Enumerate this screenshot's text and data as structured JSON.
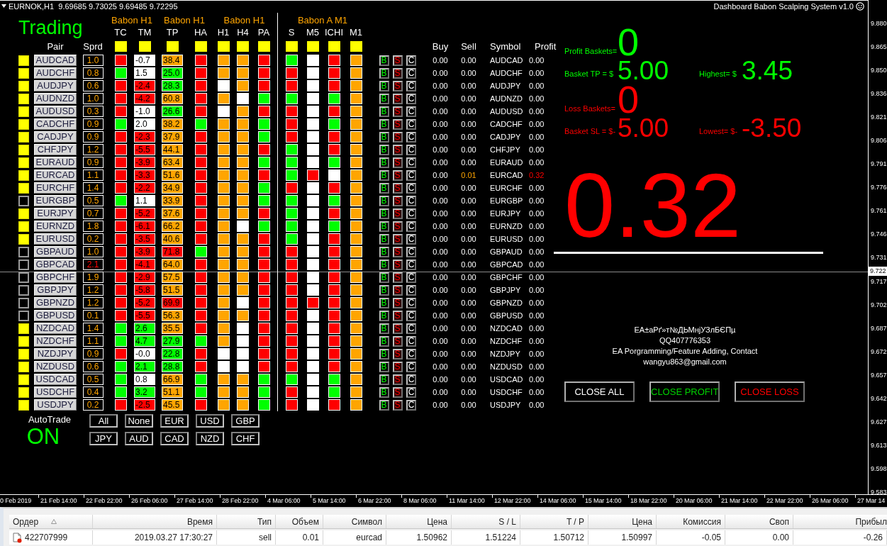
{
  "chart": {
    "symbol_line": "EURNOK,H1  9.69685 9.73025 9.69485 9.72295",
    "title": "Dashboard Babon Scalping System v1.0"
  },
  "dashboard": {
    "heading": "Trading",
    "pair_label": "Pair",
    "spread_label": "Sprd",
    "groups": [
      {
        "label": "Babon H1",
        "columns": [
          {
            "label": "TC",
            "toggle": true
          },
          {
            "label": "TM",
            "toggle": true
          }
        ]
      },
      {
        "label": "Babon H1",
        "columns": [
          {
            "label": "TP",
            "toggle": true
          },
          {
            "label": "HA",
            "toggle": true
          }
        ]
      },
      {
        "label": "Babon H1",
        "columns": [
          {
            "label": "H1",
            "toggle": true
          },
          {
            "label": "H4",
            "toggle": true
          },
          {
            "label": "PA",
            "toggle": true
          }
        ]
      },
      {
        "label": "Babon A M1",
        "columns": [
          {
            "label": "S",
            "toggle": true
          },
          {
            "label": "M5",
            "toggle": true
          },
          {
            "label": "ICHI",
            "toggle": true
          },
          {
            "label": "M1",
            "toggle": true
          }
        ]
      }
    ],
    "trade_columns": [
      "Buy",
      "Sell",
      "Symbol",
      "Profit"
    ],
    "rows": [
      {
        "selected": true,
        "pair": "AUDCAD",
        "spread": "1.0",
        "spread_alert": false,
        "cells": [
          {
            "color": "#ff0000"
          },
          {
            "value": "-0.7",
            "color": "#ffffff"
          },
          {
            "value": "38.4",
            "color": "#ffa500"
          },
          {
            "color": "#ff0000"
          },
          {
            "color": "#ffa500"
          },
          {
            "color": "#ffa500"
          },
          {
            "color": "#ff0000"
          },
          {
            "color": "#00ff00"
          },
          {
            "color": "#ffffff"
          },
          {
            "color": "#ff0000"
          },
          {
            "color": "#ffa500"
          }
        ],
        "actions": [
          "B",
          "S",
          "C"
        ],
        "buy": "0.00",
        "sell": "0.00",
        "symbol": "AUDCAD",
        "profit": "0.00",
        "open": false
      },
      {
        "selected": true,
        "pair": "AUDCHF",
        "spread": "0.8",
        "spread_alert": false,
        "cells": [
          {
            "color": "#00ff00"
          },
          {
            "value": "1.5",
            "color": "#ffffff"
          },
          {
            "value": "25.0",
            "color": "#00ff00"
          },
          {
            "color": "#ff0000"
          },
          {
            "color": "#ffa500"
          },
          {
            "color": "#ffa500"
          },
          {
            "color": "#ff0000"
          },
          {
            "color": "#ff0000"
          },
          {
            "color": "#ffffff"
          },
          {
            "color": "#ff0000"
          },
          {
            "color": "#ffa500"
          }
        ],
        "actions": [
          "B",
          "S",
          "C"
        ],
        "buy": "0.00",
        "sell": "0.00",
        "symbol": "AUDCHF",
        "profit": "0.00",
        "open": false
      },
      {
        "selected": true,
        "pair": "AUDJPY",
        "spread": "0.6",
        "spread_alert": false,
        "cells": [
          {
            "color": "#ff0000"
          },
          {
            "value": "-2.4",
            "color": "#ff0000"
          },
          {
            "value": "28.3",
            "color": "#00ff00"
          },
          {
            "color": "#ff0000"
          },
          {
            "color": "#ffffff"
          },
          {
            "color": "#ffa500"
          },
          {
            "color": "#ff0000"
          },
          {
            "color": "#ff0000"
          },
          {
            "color": "#ffffff"
          },
          {
            "color": "#ff0000"
          },
          {
            "color": "#ffa500"
          }
        ],
        "actions": [
          "B",
          "S",
          "C"
        ],
        "buy": "0.00",
        "sell": "0.00",
        "symbol": "AUDJPY",
        "profit": "0.00",
        "open": false
      },
      {
        "selected": true,
        "pair": "AUDNZD",
        "spread": "1.0",
        "spread_alert": false,
        "cells": [
          {
            "color": "#ff0000"
          },
          {
            "value": "-4.2",
            "color": "#ff0000"
          },
          {
            "value": "60.8",
            "color": "#ffa500"
          },
          {
            "color": "#ff0000"
          },
          {
            "color": "#ffa500"
          },
          {
            "color": "#ffffff"
          },
          {
            "color": "#00ff00"
          },
          {
            "color": "#00ff00"
          },
          {
            "color": "#ffffff"
          },
          {
            "color": "#00ff00"
          },
          {
            "color": "#ffa500"
          }
        ],
        "actions": [
          "B",
          "S",
          "C"
        ],
        "buy": "0.00",
        "sell": "0.00",
        "symbol": "AUDNZD",
        "profit": "0.00",
        "open": false
      },
      {
        "selected": true,
        "pair": "AUDUSD",
        "spread": "0.3",
        "spread_alert": false,
        "cells": [
          {
            "color": "#ff0000"
          },
          {
            "value": "-1.0",
            "color": "#ffffff"
          },
          {
            "value": "26.6",
            "color": "#00ff00"
          },
          {
            "color": "#ff0000"
          },
          {
            "color": "#ffffff"
          },
          {
            "color": "#ffa500"
          },
          {
            "color": "#ff0000"
          },
          {
            "color": "#ff0000"
          },
          {
            "color": "#ffffff"
          },
          {
            "color": "#ff0000"
          },
          {
            "color": "#ffa500"
          }
        ],
        "actions": [
          "B",
          "S",
          "C"
        ],
        "buy": "0.00",
        "sell": "0.00",
        "symbol": "AUDUSD",
        "profit": "0.00",
        "open": false
      },
      {
        "selected": true,
        "pair": "CADCHF",
        "spread": "0.9",
        "spread_alert": false,
        "cells": [
          {
            "color": "#00ff00"
          },
          {
            "value": "2.0",
            "color": "#ffffff"
          },
          {
            "value": "38.2",
            "color": "#ffa500"
          },
          {
            "color": "#00ff00"
          },
          {
            "color": "#ffa500"
          },
          {
            "color": "#ffa500"
          },
          {
            "color": "#00ff00"
          },
          {
            "color": "#ff0000"
          },
          {
            "color": "#ffffff"
          },
          {
            "color": "#00ff00"
          },
          {
            "color": "#ffa500"
          }
        ],
        "actions": [
          "B",
          "S",
          "C"
        ],
        "buy": "0.00",
        "sell": "0.00",
        "symbol": "CADCHF",
        "profit": "0.00",
        "open": false
      },
      {
        "selected": true,
        "pair": "CADJPY",
        "spread": "0.9",
        "spread_alert": false,
        "cells": [
          {
            "color": "#ff0000"
          },
          {
            "value": "-2.3",
            "color": "#ff0000"
          },
          {
            "value": "37.9",
            "color": "#ffa500"
          },
          {
            "color": "#ff0000"
          },
          {
            "color": "#ffa500"
          },
          {
            "color": "#ffa500"
          },
          {
            "color": "#00ff00"
          },
          {
            "color": "#ff0000"
          },
          {
            "color": "#ffffff"
          },
          {
            "color": "#ff0000"
          },
          {
            "color": "#ffa500"
          }
        ],
        "actions": [
          "B",
          "S",
          "C"
        ],
        "buy": "0.00",
        "sell": "0.00",
        "symbol": "CADJPY",
        "profit": "0.00",
        "open": false
      },
      {
        "selected": true,
        "pair": "CHFJPY",
        "spread": "1.2",
        "spread_alert": false,
        "cells": [
          {
            "color": "#ff0000"
          },
          {
            "value": "-5.5",
            "color": "#ff0000"
          },
          {
            "value": "44.1",
            "color": "#ffa500"
          },
          {
            "color": "#ff0000"
          },
          {
            "color": "#ffa500"
          },
          {
            "color": "#ffa500"
          },
          {
            "color": "#ff0000"
          },
          {
            "color": "#00ff00"
          },
          {
            "color": "#ffffff"
          },
          {
            "color": "#ff0000"
          },
          {
            "color": "#ffa500"
          }
        ],
        "actions": [
          "B",
          "S",
          "C"
        ],
        "buy": "0.00",
        "sell": "0.00",
        "symbol": "CHFJPY",
        "profit": "0.00",
        "open": false
      },
      {
        "selected": true,
        "pair": "EURAUD",
        "spread": "0.9",
        "spread_alert": false,
        "cells": [
          {
            "color": "#ff0000"
          },
          {
            "value": "-3.9",
            "color": "#ff0000"
          },
          {
            "value": "63.4",
            "color": "#ffa500"
          },
          {
            "color": "#ff0000"
          },
          {
            "color": "#ffa500"
          },
          {
            "color": "#ffa500"
          },
          {
            "color": "#00ff00"
          },
          {
            "color": "#00ff00"
          },
          {
            "color": "#ffffff"
          },
          {
            "color": "#00ff00"
          },
          {
            "color": "#ffa500"
          }
        ],
        "actions": [
          "B",
          "S",
          "C"
        ],
        "buy": "0.00",
        "sell": "0.00",
        "symbol": "EURAUD",
        "profit": "0.00",
        "open": false
      },
      {
        "selected": true,
        "pair": "EURCAD",
        "spread": "1.1",
        "spread_alert": false,
        "cells": [
          {
            "color": "#ff0000"
          },
          {
            "value": "-3.3",
            "color": "#ff0000"
          },
          {
            "value": "51.6",
            "color": "#ffa500"
          },
          {
            "color": "#ff0000"
          },
          {
            "color": "#ffa500"
          },
          {
            "color": "#ffa500"
          },
          {
            "color": "#ff0000"
          },
          {
            "color": "#00ff00"
          },
          {
            "color": "#ff0000"
          },
          {
            "color": "#ffffff"
          },
          {
            "color": "#ffa500"
          }
        ],
        "actions": [
          "B",
          "S",
          "C"
        ],
        "buy": "0.00",
        "sell": "0.01",
        "symbol": "EURCAD",
        "profit": "0.32",
        "open": true
      },
      {
        "selected": true,
        "pair": "EURCHF",
        "spread": "1.4",
        "spread_alert": false,
        "cells": [
          {
            "color": "#ff0000"
          },
          {
            "value": "-2.2",
            "color": "#ff0000"
          },
          {
            "value": "34.9",
            "color": "#ffa500"
          },
          {
            "color": "#ff0000"
          },
          {
            "color": "#ffa500"
          },
          {
            "color": "#ffa500"
          },
          {
            "color": "#00ff00"
          },
          {
            "color": "#ff0000"
          },
          {
            "color": "#ffffff"
          },
          {
            "color": "#ff0000"
          },
          {
            "color": "#ffa500"
          }
        ],
        "actions": [
          "B",
          "S",
          "C"
        ],
        "buy": "0.00",
        "sell": "0.00",
        "symbol": "EURCHF",
        "profit": "0.00",
        "open": false
      },
      {
        "selected": false,
        "pair": "EURGBP",
        "spread": "0.5",
        "spread_alert": false,
        "cells": [
          {
            "color": "#00ff00"
          },
          {
            "value": "1.1",
            "color": "#ffffff"
          },
          {
            "value": "33.9",
            "color": "#ffa500"
          },
          {
            "color": "#ff0000"
          },
          {
            "color": "#ffa500"
          },
          {
            "color": "#ffa500"
          },
          {
            "color": "#00ff00"
          },
          {
            "color": "#00ff00"
          },
          {
            "color": "#ffffff"
          },
          {
            "color": "#00ff00"
          },
          {
            "color": "#ffa500"
          }
        ],
        "actions": [
          "B",
          "S",
          "C"
        ],
        "buy": "0.00",
        "sell": "0.00",
        "symbol": "EURGBP",
        "profit": "0.00",
        "open": false
      },
      {
        "selected": true,
        "pair": "EURJPY",
        "spread": "0.7",
        "spread_alert": false,
        "cells": [
          {
            "color": "#ff0000"
          },
          {
            "value": "-5.2",
            "color": "#ff0000"
          },
          {
            "value": "37.6",
            "color": "#ffa500"
          },
          {
            "color": "#ff0000"
          },
          {
            "color": "#ffa500"
          },
          {
            "color": "#ffa500"
          },
          {
            "color": "#ff0000"
          },
          {
            "color": "#00ff00"
          },
          {
            "color": "#ffffff"
          },
          {
            "color": "#ff0000"
          },
          {
            "color": "#ffa500"
          }
        ],
        "actions": [
          "B",
          "S",
          "C"
        ],
        "buy": "0.00",
        "sell": "0.00",
        "symbol": "EURJPY",
        "profit": "0.00",
        "open": false
      },
      {
        "selected": true,
        "pair": "EURNZD",
        "spread": "1.8",
        "spread_alert": false,
        "cells": [
          {
            "color": "#ff0000"
          },
          {
            "value": "-6.1",
            "color": "#ff0000"
          },
          {
            "value": "66.2",
            "color": "#ffa500"
          },
          {
            "color": "#ff0000"
          },
          {
            "color": "#ffa500"
          },
          {
            "color": "#ffffff"
          },
          {
            "color": "#00ff00"
          },
          {
            "color": "#00ff00"
          },
          {
            "color": "#ffffff"
          },
          {
            "color": "#00ff00"
          },
          {
            "color": "#ffa500"
          }
        ],
        "actions": [
          "B",
          "S",
          "C"
        ],
        "buy": "0.00",
        "sell": "0.00",
        "symbol": "EURNZD",
        "profit": "0.00",
        "open": false
      },
      {
        "selected": true,
        "pair": "EURUSD",
        "spread": "0.2",
        "spread_alert": false,
        "cells": [
          {
            "color": "#ff0000"
          },
          {
            "value": "-3.5",
            "color": "#ff0000"
          },
          {
            "value": "40.6",
            "color": "#ffa500"
          },
          {
            "color": "#ff0000"
          },
          {
            "color": "#ffa500"
          },
          {
            "color": "#ffa500"
          },
          {
            "color": "#ff0000"
          },
          {
            "color": "#00ff00"
          },
          {
            "color": "#ffffff"
          },
          {
            "color": "#ff0000"
          },
          {
            "color": "#ffa500"
          }
        ],
        "actions": [
          "B",
          "S",
          "C"
        ],
        "buy": "0.00",
        "sell": "0.00",
        "symbol": "EURUSD",
        "profit": "0.00",
        "open": false
      },
      {
        "selected": false,
        "pair": "GBPAUD",
        "spread": "1.0",
        "spread_alert": false,
        "cells": [
          {
            "color": "#ff0000"
          },
          {
            "value": "-3.9",
            "color": "#ff0000"
          },
          {
            "value": "71.8",
            "color": "#ff0000"
          },
          {
            "color": "#00ff00"
          },
          {
            "color": "#ffa500"
          },
          {
            "color": "#ffa500"
          },
          {
            "color": "#ff0000"
          },
          {
            "color": "#ff0000"
          },
          {
            "color": "#ffffff"
          },
          {
            "color": "#ff0000"
          },
          {
            "color": "#ffa500"
          }
        ],
        "actions": [
          "B",
          "S",
          "C"
        ],
        "buy": "0.00",
        "sell": "0.00",
        "symbol": "GBPAUD",
        "profit": "0.00",
        "open": false
      },
      {
        "selected": false,
        "pair": "GBPCAD",
        "spread": "2.1",
        "spread_alert": true,
        "cells": [
          {
            "color": "#ff0000"
          },
          {
            "value": "-4.1",
            "color": "#ff0000"
          },
          {
            "value": "64.0",
            "color": "#ffa500"
          },
          {
            "color": "#ff0000"
          },
          {
            "color": "#ffa500"
          },
          {
            "color": "#ffa500"
          },
          {
            "color": "#ff0000"
          },
          {
            "color": "#ff0000"
          },
          {
            "color": "#ffffff"
          },
          {
            "color": "#ff0000"
          },
          {
            "color": "#ffa500"
          }
        ],
        "actions": [
          "B",
          "S",
          "C"
        ],
        "buy": "0.00",
        "sell": "0.00",
        "symbol": "GBPCAD",
        "profit": "0.00",
        "open": false
      },
      {
        "selected": false,
        "pair": "GBPCHF",
        "spread": "1.9",
        "spread_alert": false,
        "cells": [
          {
            "color": "#ff0000"
          },
          {
            "value": "-2.9",
            "color": "#ff0000"
          },
          {
            "value": "57.5",
            "color": "#ffa500"
          },
          {
            "color": "#ff0000"
          },
          {
            "color": "#ffa500"
          },
          {
            "color": "#ffa500"
          },
          {
            "color": "#ff0000"
          },
          {
            "color": "#ff0000"
          },
          {
            "color": "#ffffff"
          },
          {
            "color": "#ff0000"
          },
          {
            "color": "#ffa500"
          }
        ],
        "actions": [
          "B",
          "S",
          "C"
        ],
        "buy": "0.00",
        "sell": "0.00",
        "symbol": "GBPCHF",
        "profit": "0.00",
        "open": false
      },
      {
        "selected": false,
        "pair": "GBPJPY",
        "spread": "1.2",
        "spread_alert": false,
        "cells": [
          {
            "color": "#ff0000"
          },
          {
            "value": "-5.8",
            "color": "#ff0000"
          },
          {
            "value": "51.5",
            "color": "#ffa500"
          },
          {
            "color": "#ff0000"
          },
          {
            "color": "#ffa500"
          },
          {
            "color": "#ffa500"
          },
          {
            "color": "#ff0000"
          },
          {
            "color": "#ff0000"
          },
          {
            "color": "#ffffff"
          },
          {
            "color": "#ff0000"
          },
          {
            "color": "#ffa500"
          }
        ],
        "actions": [
          "B",
          "S",
          "C"
        ],
        "buy": "0.00",
        "sell": "0.00",
        "symbol": "GBPJPY",
        "profit": "0.00",
        "open": false
      },
      {
        "selected": false,
        "pair": "GBPNZD",
        "spread": "1.2",
        "spread_alert": false,
        "cells": [
          {
            "color": "#ff0000"
          },
          {
            "value": "-5.2",
            "color": "#ff0000"
          },
          {
            "value": "69.9",
            "color": "#ff0000"
          },
          {
            "color": "#ff0000"
          },
          {
            "color": "#ffa500"
          },
          {
            "color": "#ffffff"
          },
          {
            "color": "#ff0000"
          },
          {
            "color": "#ff0000"
          },
          {
            "color": "#ff0000"
          },
          {
            "color": "#ff0000"
          },
          {
            "color": "#ffa500"
          }
        ],
        "actions": [
          "B",
          "S",
          "C"
        ],
        "buy": "0.00",
        "sell": "0.00",
        "symbol": "GBPNZD",
        "profit": "0.00",
        "open": false
      },
      {
        "selected": false,
        "pair": "GBPUSD",
        "spread": "0.1",
        "spread_alert": false,
        "cells": [
          {
            "color": "#ff0000"
          },
          {
            "value": "-5.5",
            "color": "#ff0000"
          },
          {
            "value": "56.3",
            "color": "#ffa500"
          },
          {
            "color": "#ff0000"
          },
          {
            "color": "#ffa500"
          },
          {
            "color": "#ffa500"
          },
          {
            "color": "#ff0000"
          },
          {
            "color": "#ff0000"
          },
          {
            "color": "#ffffff"
          },
          {
            "color": "#ff0000"
          },
          {
            "color": "#ffa500"
          }
        ],
        "actions": [
          "B",
          "S",
          "C"
        ],
        "buy": "0.00",
        "sell": "0.00",
        "symbol": "GBPUSD",
        "profit": "0.00",
        "open": false
      },
      {
        "selected": true,
        "pair": "NZDCAD",
        "spread": "1.4",
        "spread_alert": false,
        "cells": [
          {
            "color": "#00ff00"
          },
          {
            "value": "2.6",
            "color": "#00ff00"
          },
          {
            "value": "35.5",
            "color": "#ffa500"
          },
          {
            "color": "#ff0000"
          },
          {
            "color": "#ffa500"
          },
          {
            "color": "#ffffff"
          },
          {
            "color": "#ff0000"
          },
          {
            "color": "#ff0000"
          },
          {
            "color": "#ffffff"
          },
          {
            "color": "#ff0000"
          },
          {
            "color": "#ffa500"
          }
        ],
        "actions": [
          "B",
          "S",
          "C"
        ],
        "buy": "0.00",
        "sell": "0.00",
        "symbol": "NZDCAD",
        "profit": "0.00",
        "open": false
      },
      {
        "selected": true,
        "pair": "NZDCHF",
        "spread": "1.1",
        "spread_alert": false,
        "cells": [
          {
            "color": "#00ff00"
          },
          {
            "value": "4.7",
            "color": "#00ff00"
          },
          {
            "value": "27.9",
            "color": "#00ff00"
          },
          {
            "color": "#00ff00"
          },
          {
            "color": "#ffa500"
          },
          {
            "color": "#ffffff"
          },
          {
            "color": "#ff0000"
          },
          {
            "color": "#ff0000"
          },
          {
            "color": "#ffffff"
          },
          {
            "color": "#ff0000"
          },
          {
            "color": "#ffa500"
          }
        ],
        "actions": [
          "B",
          "S",
          "C"
        ],
        "buy": "0.00",
        "sell": "0.00",
        "symbol": "NZDCHF",
        "profit": "0.00",
        "open": false
      },
      {
        "selected": true,
        "pair": "NZDJPY",
        "spread": "0.9",
        "spread_alert": false,
        "cells": [
          {
            "color": "#ff0000"
          },
          {
            "value": "-0.0",
            "color": "#ffffff"
          },
          {
            "value": "22.8",
            "color": "#00ff00"
          },
          {
            "color": "#ff0000"
          },
          {
            "color": "#ffffff"
          },
          {
            "color": "#ffffff"
          },
          {
            "color": "#ff0000"
          },
          {
            "color": "#ff0000"
          },
          {
            "color": "#ffffff"
          },
          {
            "color": "#ff0000"
          },
          {
            "color": "#ffa500"
          }
        ],
        "actions": [
          "B",
          "S",
          "C"
        ],
        "buy": "0.00",
        "sell": "0.00",
        "symbol": "NZDJPY",
        "profit": "0.00",
        "open": false
      },
      {
        "selected": true,
        "pair": "NZDUSD",
        "spread": "0.6",
        "spread_alert": false,
        "cells": [
          {
            "color": "#00ff00"
          },
          {
            "value": "2.1",
            "color": "#00ff00"
          },
          {
            "value": "28.8",
            "color": "#00ff00"
          },
          {
            "color": "#ff0000"
          },
          {
            "color": "#ffffff"
          },
          {
            "color": "#ffffff"
          },
          {
            "color": "#ff0000"
          },
          {
            "color": "#ff0000"
          },
          {
            "color": "#ffffff"
          },
          {
            "color": "#ff0000"
          },
          {
            "color": "#ffa500"
          }
        ],
        "actions": [
          "B",
          "S",
          "C"
        ],
        "buy": "0.00",
        "sell": "0.00",
        "symbol": "NZDUSD",
        "profit": "0.00",
        "open": false
      },
      {
        "selected": true,
        "pair": "USDCAD",
        "spread": "0.5",
        "spread_alert": false,
        "cells": [
          {
            "color": "#00ff00"
          },
          {
            "value": "0.8",
            "color": "#ffffff"
          },
          {
            "value": "66.9",
            "color": "#ffa500"
          },
          {
            "color": "#00ff00"
          },
          {
            "color": "#ffa500"
          },
          {
            "color": "#ffa500"
          },
          {
            "color": "#00ff00"
          },
          {
            "color": "#00ff00"
          },
          {
            "color": "#ffffff"
          },
          {
            "color": "#00ff00"
          },
          {
            "color": "#ffa500"
          }
        ],
        "actions": [
          "B",
          "S",
          "C"
        ],
        "buy": "0.00",
        "sell": "0.00",
        "symbol": "USDCAD",
        "profit": "0.00",
        "open": false
      },
      {
        "selected": true,
        "pair": "USDCHF",
        "spread": "0.4",
        "spread_alert": false,
        "cells": [
          {
            "color": "#00ff00"
          },
          {
            "value": "3.2",
            "color": "#00ff00"
          },
          {
            "value": "51.1",
            "color": "#ffa500"
          },
          {
            "color": "#00ff00"
          },
          {
            "color": "#ffa500"
          },
          {
            "color": "#ffa500"
          },
          {
            "color": "#00ff00"
          },
          {
            "color": "#ff0000"
          },
          {
            "color": "#ffffff"
          },
          {
            "color": "#00ff00"
          },
          {
            "color": "#ffa500"
          }
        ],
        "actions": [
          "B",
          "S",
          "C"
        ],
        "buy": "0.00",
        "sell": "0.00",
        "symbol": "USDCHF",
        "profit": "0.00",
        "open": false
      },
      {
        "selected": true,
        "pair": "USDJPY",
        "spread": "0.2",
        "spread_alert": false,
        "cells": [
          {
            "color": "#ff0000"
          },
          {
            "value": "-2.5",
            "color": "#ff0000"
          },
          {
            "value": "45.5",
            "color": "#ffa500"
          },
          {
            "color": "#ff0000"
          },
          {
            "color": "#ffa500"
          },
          {
            "color": "#ffa500"
          },
          {
            "color": "#00ff00"
          },
          {
            "color": "#ff0000"
          },
          {
            "color": "#ffffff"
          },
          {
            "color": "#ff0000"
          },
          {
            "color": "#ffa500"
          }
        ],
        "actions": [
          "B",
          "S",
          "C"
        ],
        "buy": "0.00",
        "sell": "0.00",
        "symbol": "USDJPY",
        "profit": "0.00",
        "open": false
      }
    ],
    "autotrade": {
      "label": "AutoTrade",
      "status": "ON",
      "on": true
    },
    "filters": [
      "All",
      "None",
      "EUR",
      "USD",
      "GBP",
      "JPY",
      "AUD",
      "CAD",
      "NZD",
      "CHF"
    ]
  },
  "summary": {
    "profit_baskets": {
      "label": "Profit Baskets=",
      "value": "0"
    },
    "basket_tp": {
      "label": "Basket TP = $",
      "value": "5.00"
    },
    "highest": {
      "label": "Highest= $",
      "value": "3.45"
    },
    "loss_baskets": {
      "label": "Loss Baskets=",
      "value": "0"
    },
    "basket_sl": {
      "label": "Basket SL = $-",
      "value": "5.00"
    },
    "lowest": {
      "label": "Lowest= $-",
      "value": "-3.50"
    },
    "total_profit": "0.32",
    "info": [
      "EA±aPґ»т№ДЬМнјУЗлБЄПµ",
      "QQ407776353",
      "EA Porgramming/Feature Adding, Contact",
      "wangyu863@gmail.com"
    ],
    "buttons": [
      {
        "label": "CLOSE ALL",
        "kind": "all"
      },
      {
        "label": "CLOSE PROFIT",
        "kind": "profit"
      },
      {
        "label": "CLOSE LOSS",
        "kind": "loss"
      }
    ]
  },
  "price_axis": {
    "labels": [
      "9.880",
      "9.865",
      "9.850",
      "9.836",
      "9.821",
      "9.806",
      "9.791",
      "9.776",
      "9.761",
      "9.746",
      "9.731",
      "9.717",
      "9.702",
      "9.687",
      "9.672",
      "9.657",
      "9.642",
      "9.627",
      "9.613",
      "9.598",
      "9.583"
    ],
    "current": "9.722"
  },
  "time_axis": {
    "labels": [
      "0 Feb 2019",
      "21 Feb 14:00",
      "22 Feb 22:00",
      "26 Feb 06:00",
      "27 Feb 14:00",
      "28 Feb 22:00",
      "4 Mar 06:00",
      "5 Mar 14:00",
      "6 Mar 22:00",
      "8 Mar 06:00",
      "11 Mar 14:00",
      "12 Mar 22:00",
      "14 Mar 06:00",
      "15 Mar 14:00",
      "18 Mar 22:00",
      "20 Mar 06:00",
      "21 Mar 14:00",
      "22 Mar 22:00",
      "26 Mar 06:00",
      "27 Mar 14"
    ]
  },
  "terminal": {
    "columns": [
      {
        "label": "Ордер",
        "sorted": true
      },
      {
        "label": "Время",
        "sorted": false
      },
      {
        "label": "Тип",
        "sorted": false
      },
      {
        "label": "Объем",
        "sorted": false
      },
      {
        "label": "Символ",
        "sorted": false
      },
      {
        "label": "Цена",
        "sorted": false
      },
      {
        "label": "S / L",
        "sorted": false
      },
      {
        "label": "T / P",
        "sorted": false
      },
      {
        "label": "Цена",
        "sorted": false
      },
      {
        "label": "Комиссия",
        "sorted": false
      },
      {
        "label": "Своп",
        "sorted": false
      },
      {
        "label": "Прибыл",
        "sorted": false
      }
    ],
    "rows": [
      {
        "cells": [
          "422707999",
          "2019.03.27 17:30:27",
          "sell",
          "0.01",
          "eurcad",
          "1.50962",
          "1.51224",
          "1.50712",
          "1.50997",
          "-0.05",
          "0.00",
          "-0.26"
        ]
      }
    ]
  }
}
